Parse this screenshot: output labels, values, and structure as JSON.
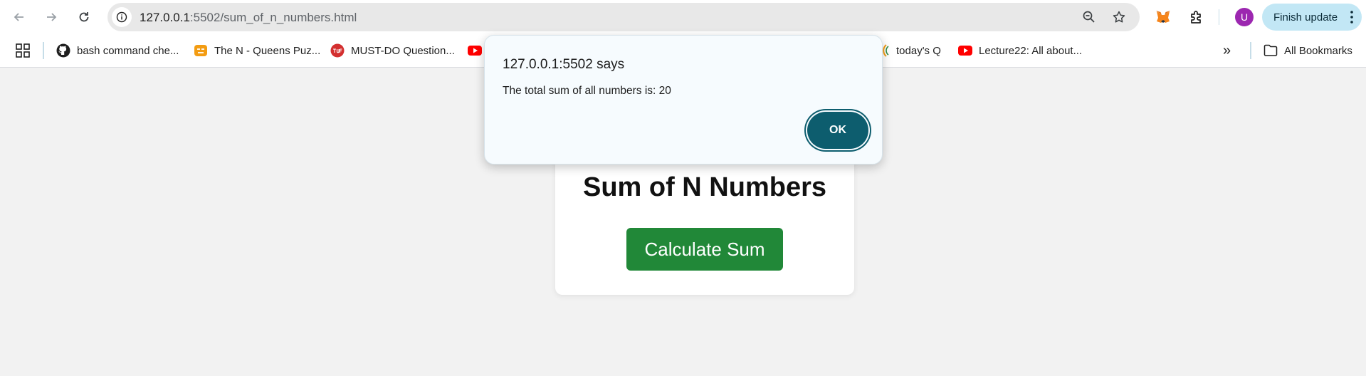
{
  "browser": {
    "url_host": "127.0.0.1",
    "url_rest": ":5502/sum_of_n_numbers.html",
    "icons": [
      "back-icon",
      "forward-icon",
      "reload-icon",
      "site-info-icon",
      "zoom-icon",
      "star-icon",
      "metamask-icon",
      "extensions-icon",
      "more-icon"
    ],
    "profile_initial": "U",
    "finish_update_label": "Finish update"
  },
  "bookmarks": {
    "items": [
      {
        "label": "bash command che...",
        "icon": "github-icon"
      },
      {
        "label": "The N - Queens Puz...",
        "icon": "puzzle-site-icon"
      },
      {
        "label": "MUST-DO Question...",
        "icon": "tuf-icon"
      },
      {
        "label": "",
        "icon": "youtube-icon"
      },
      {
        "label": "today's Q",
        "icon": "geeks-icon"
      },
      {
        "label": "Lecture22: All about...",
        "icon": "youtube-icon"
      }
    ],
    "overflow_label": "»",
    "all_bookmarks_label": "All Bookmarks"
  },
  "page": {
    "title": "Sum of N Numbers",
    "button_label": "Calculate Sum"
  },
  "dialog": {
    "title": "127.0.0.1:5502 says",
    "message": "The total sum of all numbers is: 20",
    "ok_label": "OK"
  },
  "colors": {
    "button_green": "#218838",
    "dialog_ok": "#0d5d6e",
    "finish_update_bg": "#c2e7f5"
  }
}
